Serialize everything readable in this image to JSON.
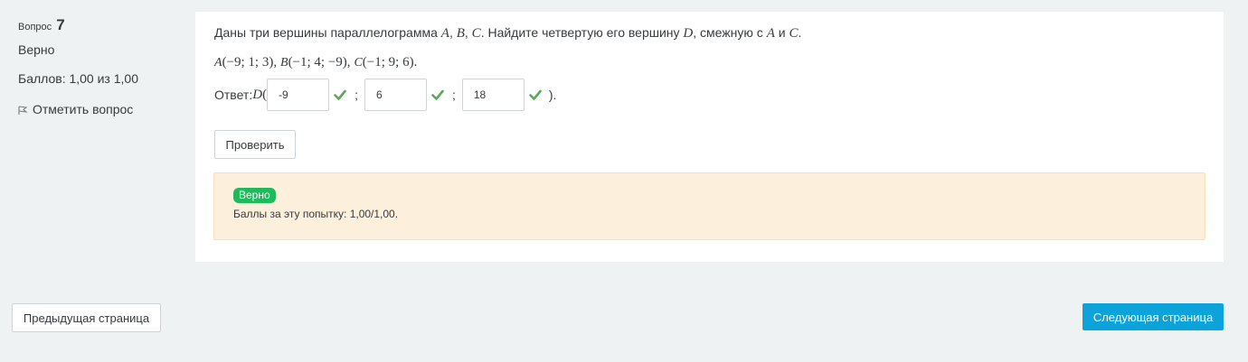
{
  "question_info": {
    "label": "Вопрос",
    "number": "7",
    "state": "Верно",
    "grade": "Баллов: 1,00 из 1,00",
    "flag_label": "Отметить вопрос"
  },
  "question": {
    "text_parts": [
      "Даны три вершины параллелограмма ",
      "A",
      ", ",
      "B",
      ", ",
      "C",
      ". Найдите четвертую его вершину ",
      "D",
      ", смежную с ",
      "A",
      " и ",
      "C",
      "."
    ],
    "points": {
      "A_name": "A",
      "A_coords": "(−9; 1; 3),",
      "B_name": "B",
      "B_coords": "(−1; 4; −9),",
      "C_name": "C",
      "C_coords": "(−1; 9; 6)."
    },
    "answer_prefix": "Ответ: ",
    "answer_point": "D",
    "answer_open": "(",
    "answer_values": [
      "-9",
      "6",
      "18"
    ],
    "separator": ";",
    "answer_close": ")."
  },
  "check_button": "Проверить",
  "feedback": {
    "badge": "Верно",
    "text": "Баллы за эту попытку: 1,00/1,00."
  },
  "navigation": {
    "prev": "Предыдущая страница",
    "next": "Следующая страница"
  },
  "colors": {
    "check_green": "#5aa85a",
    "badge_green": "#1fba5b",
    "next_button": "#0ba3d9",
    "feedback_bg": "#fcefdc"
  }
}
